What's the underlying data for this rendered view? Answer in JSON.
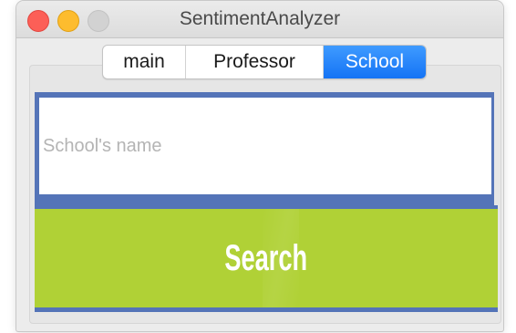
{
  "window": {
    "title": "SentimentAnalyzer"
  },
  "tabs": [
    {
      "label": "main",
      "selected": false
    },
    {
      "label": "Professor",
      "selected": false
    },
    {
      "label": "School",
      "selected": true
    }
  ],
  "search": {
    "placeholder": "School's name",
    "value": "",
    "button_label": "Search"
  },
  "colors": {
    "accent_tab": "#1f7ff7",
    "input_border": "#5474b8",
    "search_button": "#b0d136"
  }
}
